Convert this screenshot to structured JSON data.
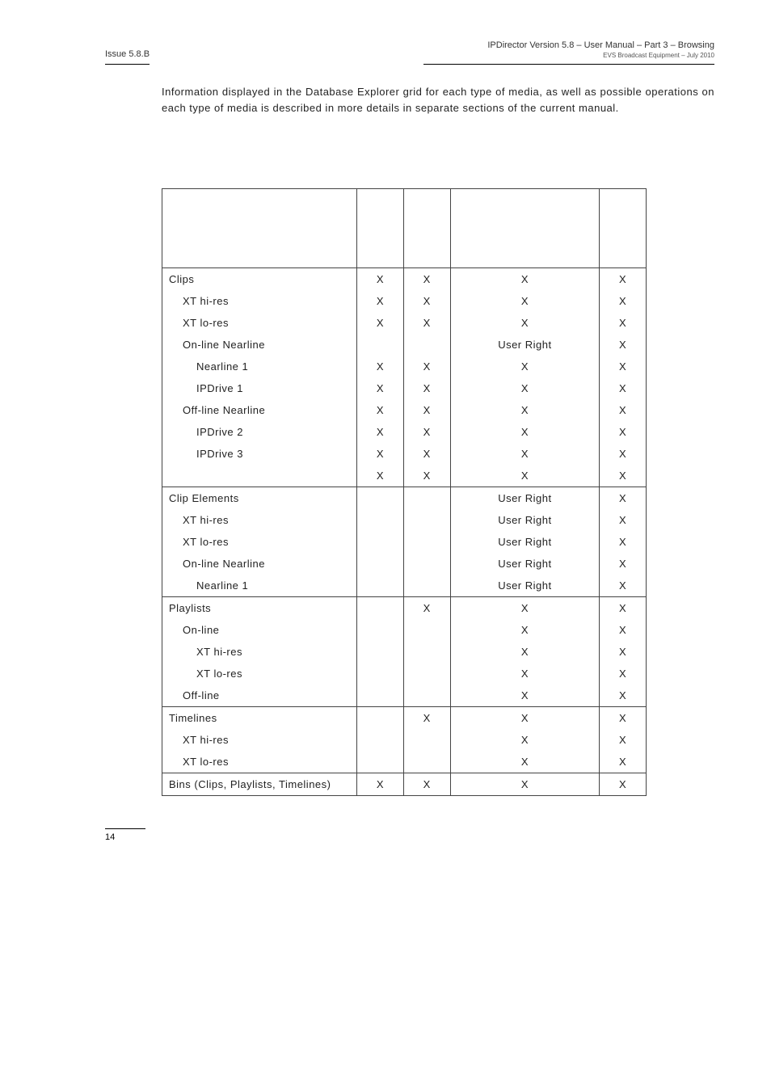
{
  "header": {
    "left": "Issue 5.8.B",
    "right_main": "IPDirector Version 5.8 – User Manual – Part 3 – Browsing",
    "right_sub": "EVS Broadcast Equipment – July 2010"
  },
  "intro": "Information displayed in the Database Explorer grid for each type of media, as well as possible operations on each type of media is described in more details in separate sections of the current manual.",
  "chart_data": {
    "type": "table",
    "columns": [
      "",
      "",
      "",
      "",
      ""
    ],
    "sections": [
      {
        "rows": [
          {
            "label": "Clips",
            "indent": 0,
            "cells": [
              "X",
              "X",
              "X",
              "X"
            ]
          },
          {
            "label": "XT hi-res",
            "indent": 1,
            "cells": [
              "X",
              "X",
              "X",
              "X"
            ]
          },
          {
            "label": "XT lo-res",
            "indent": 1,
            "cells": [
              "X",
              "X",
              "X",
              "X"
            ]
          },
          {
            "label": "On-line Nearline",
            "indent": 1,
            "cells": [
              "",
              "",
              "User Right",
              "X"
            ]
          },
          {
            "label": "Nearline 1",
            "indent": 2,
            "cells": [
              "X",
              "X",
              "X",
              "X"
            ]
          },
          {
            "label": "IPDrive 1",
            "indent": 2,
            "cells": [
              "X",
              "X",
              "X",
              "X"
            ]
          },
          {
            "label": "Off-line Nearline",
            "indent": 1,
            "cells": [
              "X",
              "X",
              "X",
              "X"
            ]
          },
          {
            "label": "IPDrive 2",
            "indent": 2,
            "cells": [
              "X",
              "X",
              "X",
              "X"
            ]
          },
          {
            "label": "IPDrive 3",
            "indent": 2,
            "cells": [
              "X",
              "X",
              "X",
              "X"
            ]
          },
          {
            "label": "",
            "indent": 0,
            "cells": [
              "X",
              "X",
              "X",
              "X"
            ]
          }
        ]
      },
      {
        "rows": [
          {
            "label": "Clip Elements",
            "indent": 0,
            "cells": [
              "",
              "",
              "User Right",
              "X"
            ]
          },
          {
            "label": "XT hi-res",
            "indent": 1,
            "cells": [
              "",
              "",
              "User Right",
              "X"
            ]
          },
          {
            "label": "XT lo-res",
            "indent": 1,
            "cells": [
              "",
              "",
              "User Right",
              "X"
            ]
          },
          {
            "label": "On-line Nearline",
            "indent": 1,
            "cells": [
              "",
              "",
              "User Right",
              "X"
            ]
          },
          {
            "label": "Nearline 1",
            "indent": 2,
            "cells": [
              "",
              "",
              "User Right",
              "X"
            ]
          }
        ]
      },
      {
        "rows": [
          {
            "label": "Playlists",
            "indent": 0,
            "cells": [
              "",
              "X",
              "X",
              "X"
            ]
          },
          {
            "label": "On-line",
            "indent": 1,
            "cells": [
              "",
              "",
              "X",
              "X"
            ]
          },
          {
            "label": "XT hi-res",
            "indent": 2,
            "cells": [
              "",
              "",
              "X",
              "X"
            ]
          },
          {
            "label": "XT lo-res",
            "indent": 2,
            "cells": [
              "",
              "",
              "X",
              "X"
            ]
          },
          {
            "label": "Off-line",
            "indent": 1,
            "cells": [
              "",
              "",
              "X",
              "X"
            ]
          }
        ]
      },
      {
        "rows": [
          {
            "label": "Timelines",
            "indent": 0,
            "cells": [
              "",
              "X",
              "X",
              "X"
            ]
          },
          {
            "label": "XT hi-res",
            "indent": 1,
            "cells": [
              "",
              "",
              "X",
              "X"
            ]
          },
          {
            "label": "XT lo-res",
            "indent": 1,
            "cells": [
              "",
              "",
              "X",
              "X"
            ]
          }
        ]
      },
      {
        "rows": [
          {
            "label": "Bins (Clips, Playlists, Timelines)",
            "indent": 0,
            "cells": [
              "X",
              "X",
              "X",
              "X"
            ]
          }
        ]
      }
    ]
  },
  "footer": {
    "page": "14"
  }
}
